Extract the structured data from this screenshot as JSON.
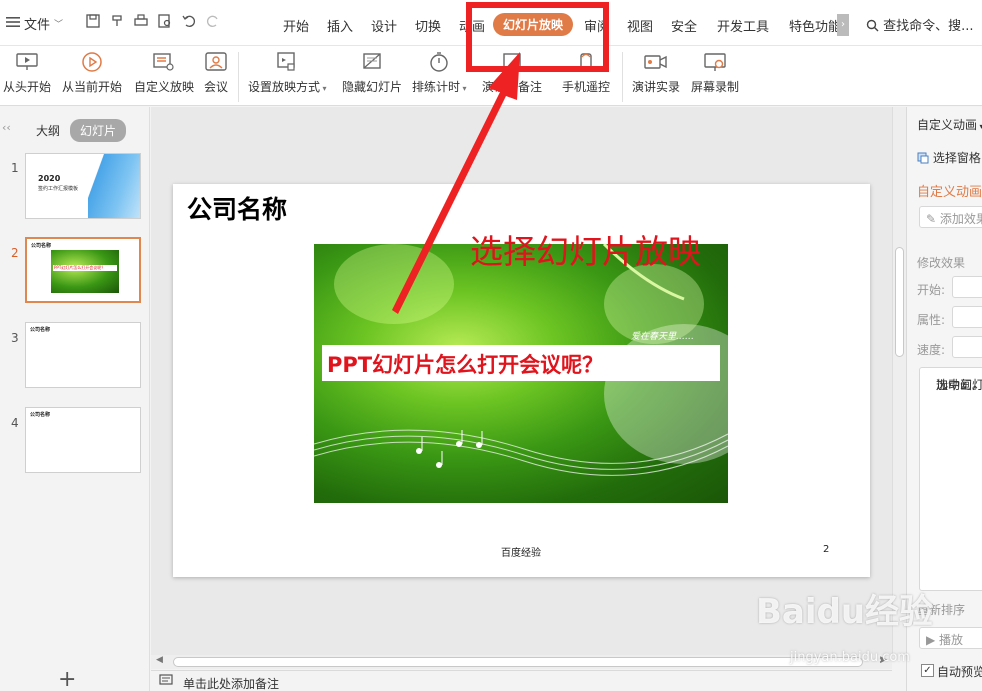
{
  "menubar": {
    "file_label": "文件",
    "tabs": [
      "开始",
      "插入",
      "设计",
      "切换",
      "动画",
      "幻灯片放映",
      "审阅",
      "视图",
      "安全",
      "开发工具",
      "特色功能"
    ],
    "active_tab": "幻灯片放映",
    "search_placeholder": "查找命令、搜..."
  },
  "ribbon": {
    "buttons": [
      "从头开始",
      "从当前开始",
      "自定义放映",
      "会议",
      "设置放映方式",
      "隐藏幻灯片",
      "排练计时",
      "演讲者备注",
      "手机遥控",
      "演讲实录",
      "屏幕录制"
    ]
  },
  "leftpane": {
    "tabs": [
      "大纲",
      "幻灯片"
    ],
    "active_tab": "幻灯片",
    "thumbnails": [
      {
        "num": "1",
        "year": "2020",
        "subtitle": "签约工作汇报模板"
      },
      {
        "num": "2",
        "title": "公司名称",
        "banner": "PPT幻灯片怎么打开会议呢？"
      },
      {
        "num": "3",
        "title": "公司名称"
      },
      {
        "num": "4",
        "title": "公司名称"
      }
    ],
    "add_symbol": "+"
  },
  "slide": {
    "title": "公司名称",
    "banner_text": "PPT幻灯片怎么打开会议呢？",
    "image_caption": "爱在春天里……",
    "footer": "百度经验",
    "page_number": "2"
  },
  "annotation": {
    "text": "选择幻灯片放映",
    "color": "#e0141c"
  },
  "notes": {
    "placeholder": "单击此处添加备注"
  },
  "rightpane": {
    "title": "自定义动画",
    "select_pane": "选择窗格",
    "section": "自定义动画",
    "add_effect": "添加效果",
    "modify": "修改效果",
    "start_label": "开始:",
    "property_label": "属性:",
    "speed_label": "速度:",
    "hint_line1": "选中幻灯片",
    "hint_line2": "加动画。",
    "reorder": "重新排序",
    "play": "播放",
    "autopreview": "自动预览"
  },
  "watermark": {
    "logo": "Baidu经验",
    "url": "jingyan.baidu.com"
  },
  "colors": {
    "accent": "#e07a46",
    "annotation_red": "#ee2222"
  }
}
